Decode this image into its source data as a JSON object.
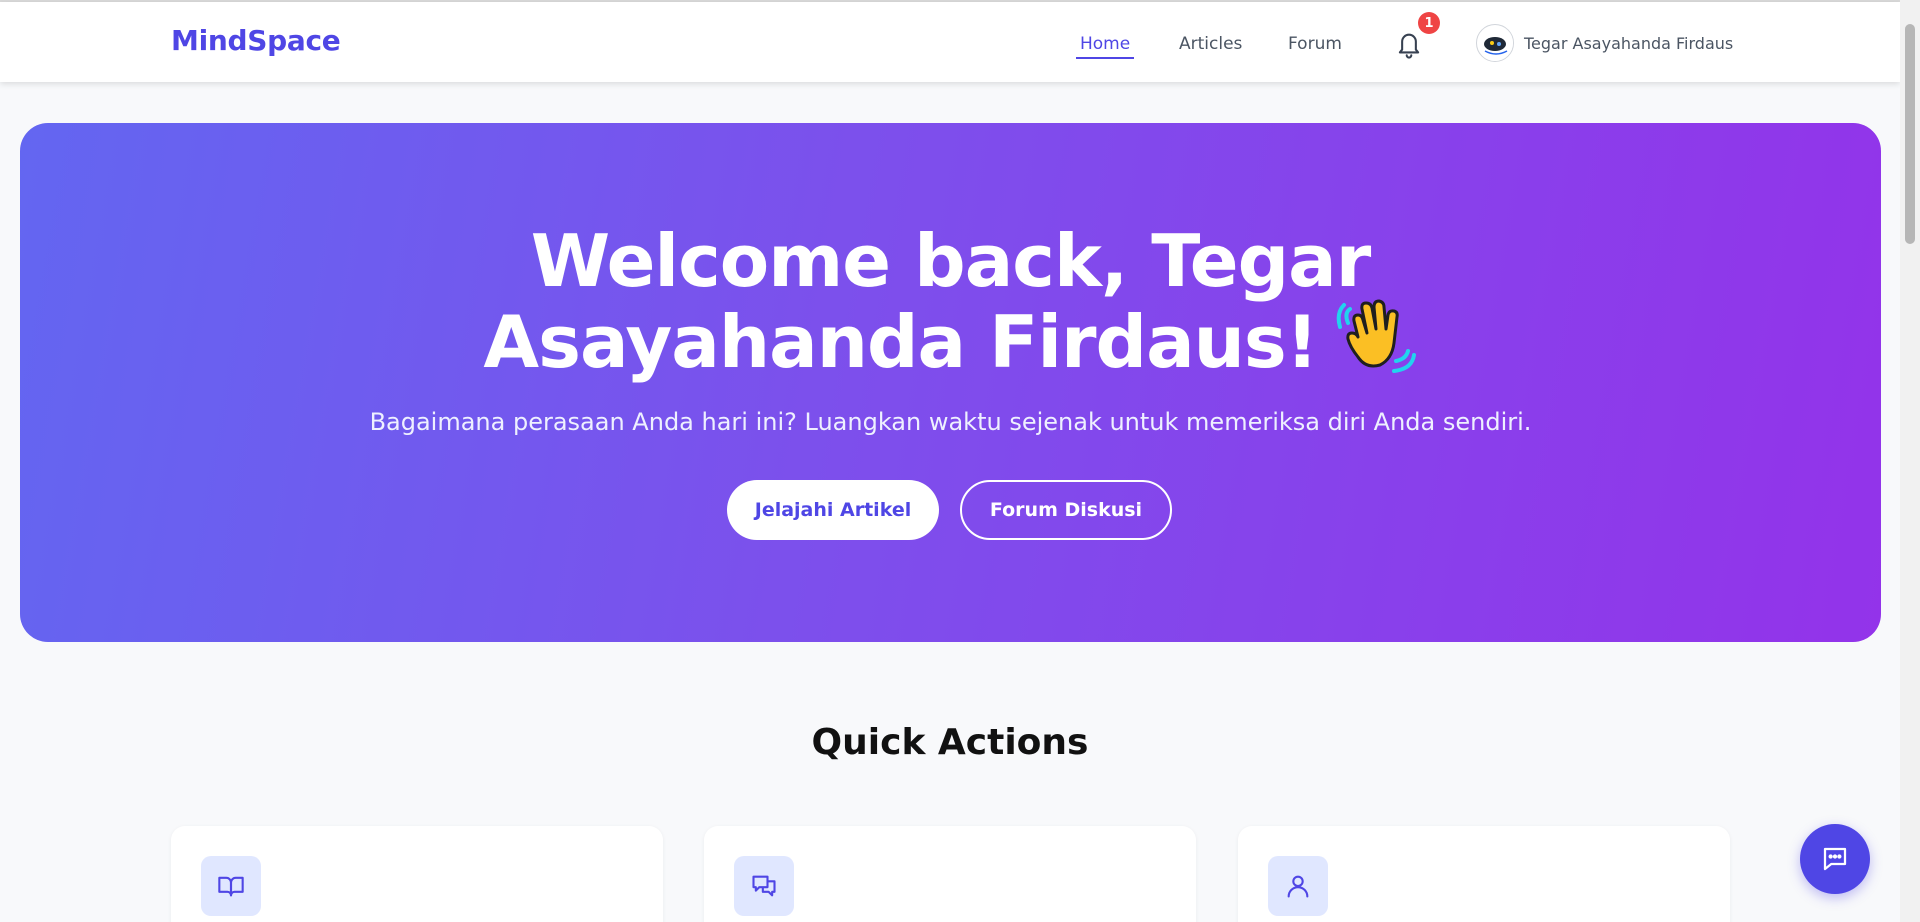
{
  "app": {
    "brand": "MindSpace"
  },
  "nav": {
    "links": [
      {
        "label": "Home",
        "active": true
      },
      {
        "label": "Articles",
        "active": false
      },
      {
        "label": "Forum",
        "active": false
      }
    ],
    "notification_count": "1",
    "user_name": "Tegar Asayahanda Firdaus"
  },
  "hero": {
    "title_line1": "Welcome back, Tegar",
    "title_line2": "Asayahanda Firdaus!",
    "emoji": "waving-hand-icon",
    "subtitle": "Bagaimana perasaan Anda hari ini? Luangkan waktu sejenak untuk memeriksa diri Anda sendiri.",
    "primary_button": "Jelajahi Artikel",
    "secondary_button": "Forum Diskusi"
  },
  "quick_actions": {
    "title": "Quick Actions",
    "cards": [
      {
        "icon": "book-icon"
      },
      {
        "icon": "chat-bubbles-icon"
      },
      {
        "icon": "user-icon"
      }
    ]
  },
  "colors": {
    "brand": "#4f46e5",
    "hero_gradient_start": "#6366f1",
    "hero_gradient_end": "#9333ea",
    "badge": "#ef4444",
    "icon_bg": "#e0e7ff"
  }
}
